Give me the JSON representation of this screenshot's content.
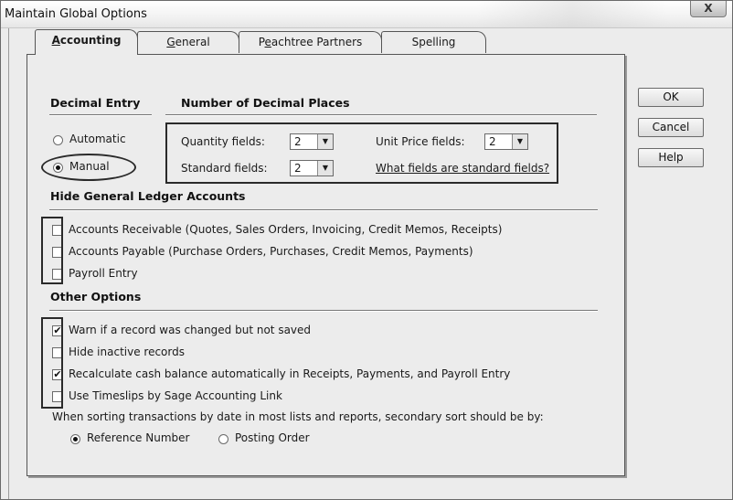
{
  "window": {
    "title": "Maintain Global Options",
    "close_glyph": "X"
  },
  "tabs": [
    {
      "label": "Accounting",
      "mnemonic": "A",
      "rest": "ccounting"
    },
    {
      "label": "General",
      "mnemonic": "G",
      "rest": "eneral"
    },
    {
      "label": "Peachtree Partners",
      "pre": "P",
      "mnemonic": "e",
      "rest": "achtree Partners"
    },
    {
      "label": "Spelling"
    }
  ],
  "buttons": {
    "ok": "OK",
    "cancel": "Cancel",
    "help": "Help"
  },
  "decimal_entry": {
    "header": "Decimal Entry",
    "automatic": "Automatic",
    "manual": "Manual",
    "selected": "Manual"
  },
  "decimal_places": {
    "header": "Number of Decimal Places",
    "quantity_label": "Quantity fields:",
    "quantity_value": "2",
    "standard_label": "Standard fields:",
    "standard_value": "2",
    "unit_price_label": "Unit Price fields:",
    "unit_price_value": "2",
    "help_link": "What fields are standard fields?"
  },
  "hide_gl": {
    "header": "Hide General Ledger Accounts",
    "items": [
      {
        "label": "Accounts Receivable (Quotes, Sales Orders, Invoicing, Credit Memos, Receipts)",
        "checked": false
      },
      {
        "label": "Accounts Payable (Purchase Orders, Purchases, Credit Memos, Payments)",
        "checked": false
      },
      {
        "label": "Payroll Entry",
        "checked": false
      }
    ]
  },
  "other": {
    "header": "Other Options",
    "items": [
      {
        "label": "Warn if a record was changed but not saved",
        "checked": true
      },
      {
        "label": "Hide inactive records",
        "checked": false
      },
      {
        "label": "Recalculate cash balance automatically in Receipts, Payments, and Payroll Entry",
        "checked": true
      },
      {
        "label": "Use Timeslips by Sage Accounting Link",
        "checked": false
      }
    ],
    "sort_text": "When sorting transactions by date in most lists and reports, secondary sort should be by:",
    "sort_reference": "Reference Number",
    "sort_posting": "Posting Order",
    "sort_selected": "Reference Number"
  },
  "checkmark_glyph": "✔",
  "combo_arrow_glyph": "▼"
}
